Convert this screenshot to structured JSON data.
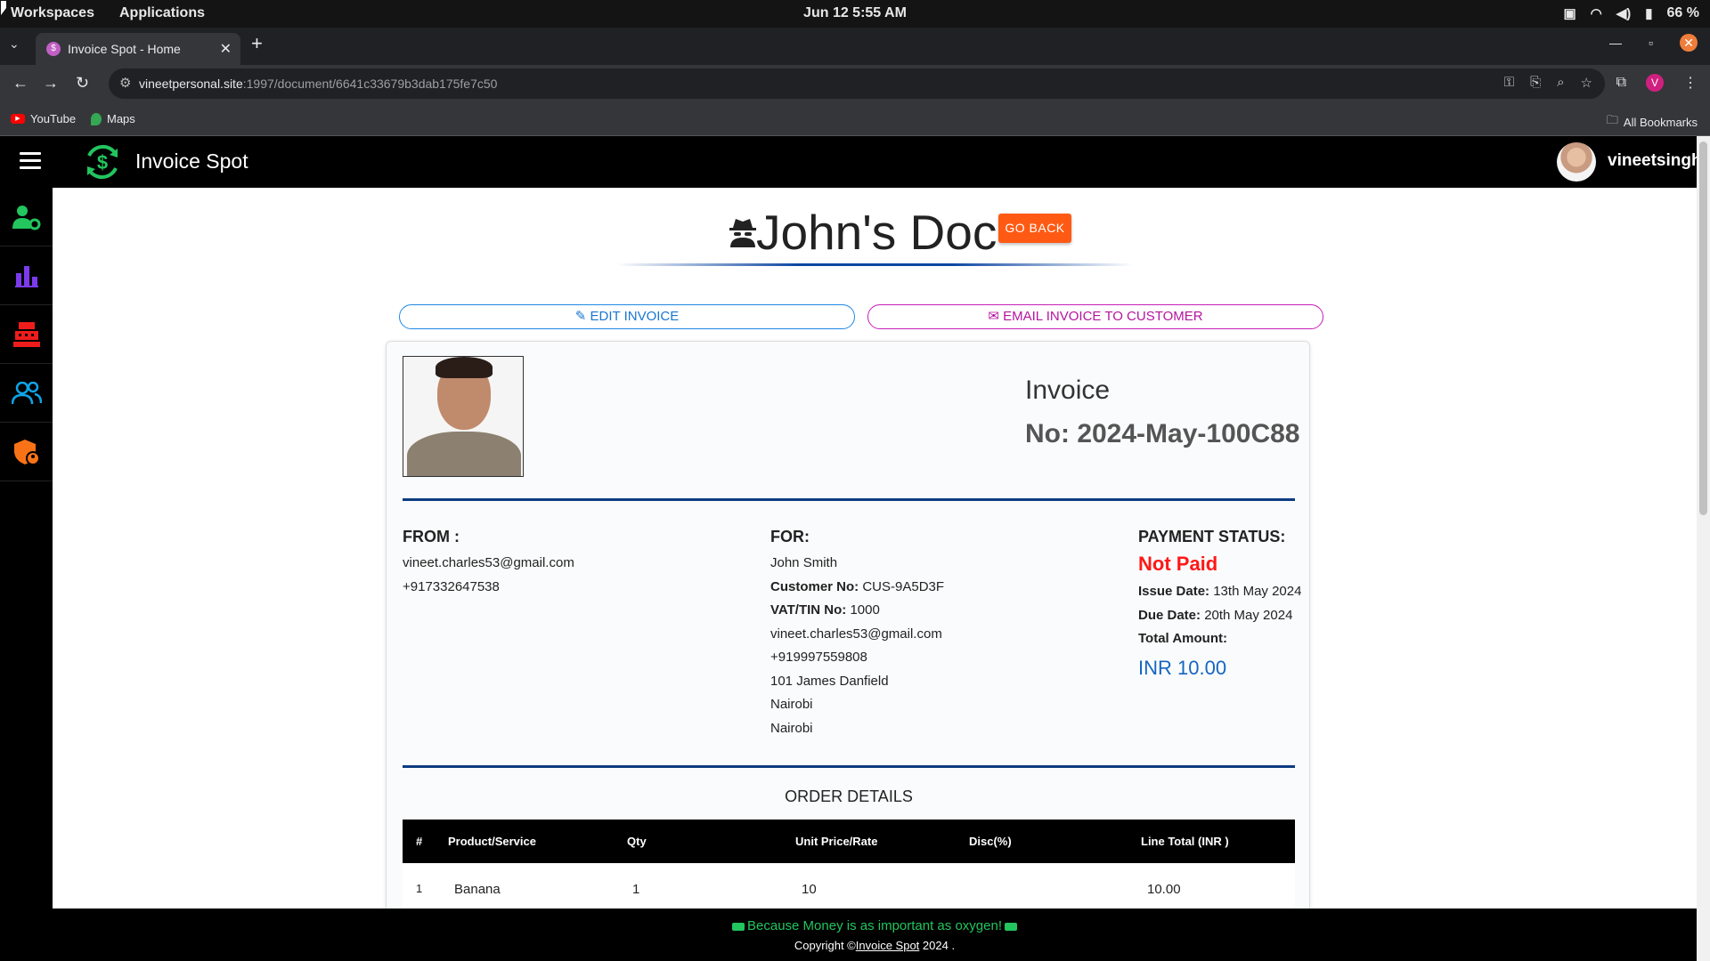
{
  "os": {
    "workspaces": "Workspaces",
    "applications": "Applications",
    "datetime": "Jun 12  5:55 AM",
    "battery": "66 %"
  },
  "browser": {
    "tab_title": "Invoice Spot - Home",
    "url_host": "vineetpersonal.site",
    "url_path": ":1997/document/6641c33679b3dab175fe7c50",
    "bookmarks": [
      "YouTube",
      "Maps"
    ],
    "all_bookmarks": "All Bookmarks",
    "profile_initial": "V"
  },
  "app": {
    "brand": "Invoice Spot",
    "username": "vineetsingh",
    "sidebar_icons": [
      "user-settings-icon",
      "bar-chart-icon",
      "cash-register-icon",
      "users-icon",
      "shield-user-icon"
    ],
    "sidebar_colors": [
      "#22c55e",
      "#7c3aed",
      "#ef1c1c",
      "#0ea5e9",
      "#f97316"
    ]
  },
  "doc": {
    "title": "John's Doc",
    "go_back": "GO BACK",
    "edit_invoice": "EDIT INVOICE",
    "email_invoice": "EMAIL INVOICE TO CUSTOMER"
  },
  "invoice": {
    "label": "Invoice",
    "number": "No: 2024-May-100C88",
    "from": {
      "heading": "FROM :",
      "email": "vineet.charles53@gmail.com",
      "phone": "+917332647538"
    },
    "for": {
      "heading": "FOR:",
      "name": "John Smith",
      "customer_no_label": "Customer No:",
      "customer_no": "CUS-9A5D3F",
      "vat_label": "VAT/TIN No:",
      "vat": "1000",
      "email": "vineet.charles53@gmail.com",
      "phone": "+919997559808",
      "address": "101 James Danfield",
      "city": "Nairobi",
      "country": "Nairobi"
    },
    "payment": {
      "heading": "PAYMENT STATUS:",
      "status": "Not Paid",
      "issue_label": "Issue Date:",
      "issue_date": "13th May 2024",
      "due_label": "Due Date:",
      "due_date": "20th May 2024",
      "total_label": "Total Amount:",
      "total": "INR 10.00"
    },
    "order_title": "ORDER DETAILS",
    "columns": [
      "#",
      "Product/Service",
      "Qty",
      "Unit Price/Rate",
      "Disc(%)",
      "Line Total (INR )"
    ],
    "rows": [
      [
        "1",
        "Banana",
        "1",
        "10",
        "",
        "10.00"
      ]
    ]
  },
  "footer": {
    "slogan": "Because Money is as important as oxygen!",
    "copy_prefix": "Copyright ©",
    "copy_link": "Invoice Spot",
    "copy_suffix": " 2024 ."
  },
  "colors": {
    "go_back": "#ff5a14",
    "edit": "#1976d2",
    "email": "#b4159f",
    "not_paid": "#ff1717",
    "amount": "#1565c0",
    "slogan": "#22c55e"
  }
}
